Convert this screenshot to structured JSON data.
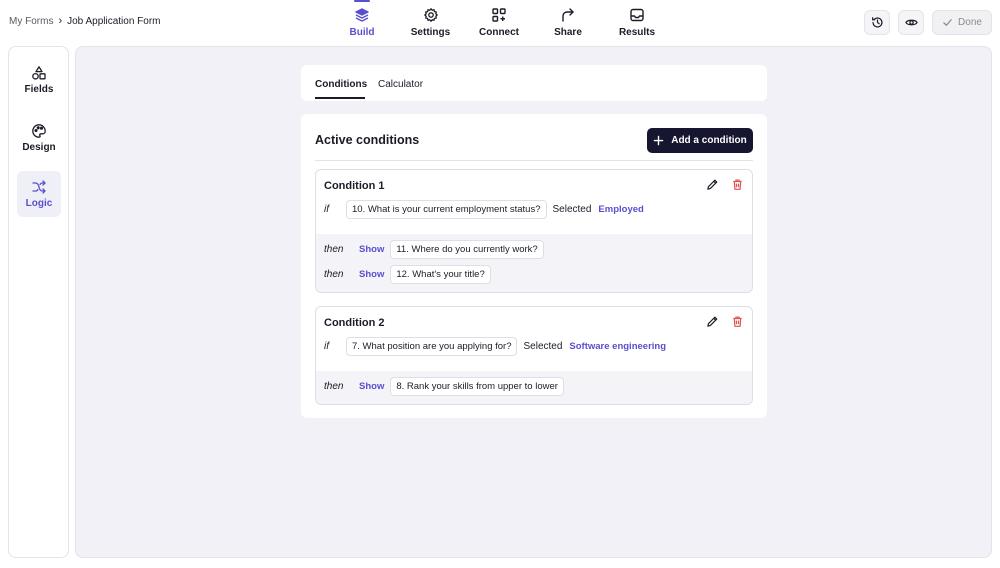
{
  "breadcrumb": {
    "parent": "My Forms",
    "separator": "›",
    "current": "Job Application Form"
  },
  "topnav": [
    {
      "label": "Build",
      "icon": "layers-icon",
      "active": true
    },
    {
      "label": "Settings",
      "icon": "gear-icon",
      "active": false
    },
    {
      "label": "Connect",
      "icon": "connect-icon",
      "active": false
    },
    {
      "label": "Share",
      "icon": "share-icon",
      "active": false
    },
    {
      "label": "Results",
      "icon": "inbox-icon",
      "active": false
    }
  ],
  "actions": {
    "history_icon": "history-icon",
    "preview_icon": "eye-icon",
    "done_label": "Done"
  },
  "rail": [
    {
      "label": "Fields",
      "icon": "shapes-icon",
      "active": false
    },
    {
      "label": "Design",
      "icon": "palette-icon",
      "active": false
    },
    {
      "label": "Logic",
      "icon": "shuffle-icon",
      "active": true
    }
  ],
  "tabs": [
    {
      "label": "Conditions",
      "active": true
    },
    {
      "label": "Calculator",
      "active": false
    }
  ],
  "conditions_panel": {
    "title": "Active conditions",
    "add_label": "Add a condition",
    "items": [
      {
        "title": "Condition 1",
        "if_keyword": "if",
        "question": "10. What is your current employment status?",
        "operator": "Selected",
        "value": "Employed",
        "actions": [
          {
            "keyword": "then",
            "verb": "Show",
            "target": "11. Where do you currently work?"
          },
          {
            "keyword": "then",
            "verb": "Show",
            "target": "12. What's your title?"
          }
        ]
      },
      {
        "title": "Condition 2",
        "if_keyword": "if",
        "question": "7. What position are you applying for?",
        "operator": "Selected",
        "value": "Software engineering",
        "actions": [
          {
            "keyword": "then",
            "verb": "Show",
            "target": "8. Rank your skills from upper to lower"
          }
        ]
      }
    ]
  },
  "colors": {
    "accent": "#5a4fcf",
    "primary_button": "#161630",
    "delete": "#e05252",
    "canvas_bg": "#f1f1f7"
  }
}
